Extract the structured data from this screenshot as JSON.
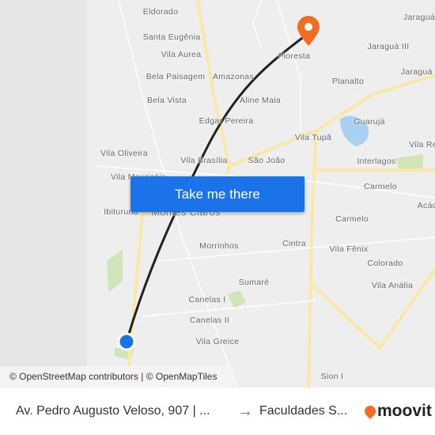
{
  "map": {
    "labels": [
      "Eldorado",
      "Santa Eugênia",
      "Vila Aurea",
      "Bela Paisagem",
      "Amazonas",
      "Bela Vista",
      "Aline Maia",
      "Edgar Pereira",
      "Vila Oliveira",
      "Vila Brasília",
      "São João",
      "Vila Tupã",
      "Guarujá",
      "Vila Re",
      "Interlagos",
      "Carmelo",
      "Acác",
      "Vila Mauricéia",
      "Ibituruna",
      "Montes Claros",
      "Carmelo",
      "Cintra",
      "Morrinhos",
      "Vila Fênix",
      "Colorado",
      "Sumaré",
      "Vila Anália",
      "Canelas I",
      "Canelas II",
      "Vila Greice",
      "Sion I",
      "Floresta",
      "Planalto",
      "Jaraguá",
      "Jaraguá III",
      "Jaraguá I"
    ],
    "origin_color": "#1a73e8",
    "destination_color": "#f26c22",
    "route_color": "#222222"
  },
  "cta_label": "Take me there",
  "attribution": "© OpenStreetMap contributors | © OpenMapTiles",
  "footer": {
    "from": "Av. Pedro Augusto Veloso, 907 | ...",
    "arrow": "→",
    "to": "Faculdades S...",
    "brand": "moovit"
  }
}
